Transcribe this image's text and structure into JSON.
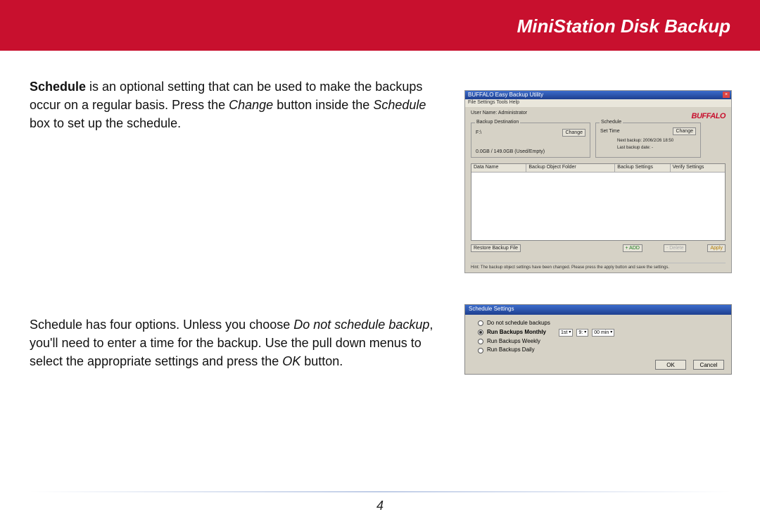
{
  "header": {
    "title": "MiniStation Disk Backup"
  },
  "para1": {
    "lead": "Schedule",
    "rest_a": " is an optional setting that can be used to make the backups occur on a regular basis.  Press the ",
    "em1": "Change",
    "rest_b": " button inside the ",
    "em2": "Schedule",
    "rest_c": " box to set up the schedule."
  },
  "para2": {
    "a": "Schedule has four options.  Unless you choose ",
    "em1": "Do not schedule backup",
    "b": ", you'll need to enter a time for the backup.  Use the pull down menus to select the appropriate settings and press the ",
    "em2": "OK",
    "c": " button."
  },
  "shot1": {
    "title": "BUFFALO Easy Backup Utility",
    "menu": "File   Settings   Tools   Help",
    "brand": "BUFFALO",
    "username": "User Name: Administrator",
    "dest_label": "Backup Destination",
    "dest_drive": "F:\\",
    "dest_change": "Change",
    "dest_size": "0.0GB / 149.0GB  (Used/Empty)",
    "sched_label": "Schedule",
    "sched_settime": "Set Time",
    "sched_change": "Change",
    "sched_next": "Next backup: 2006/2/26 18:50",
    "sched_last": "Last backup date: -",
    "thead": {
      "c1": "Data Name",
      "c2": "Backup Object Folder",
      "c3": "Backup Settings",
      "c4": "Verify Settings"
    },
    "restore": "Restore Backup File",
    "add": "+ ADD",
    "delete": "- Delete",
    "apply": "Apply",
    "hint": "Hint: The backup object settings have been changed. Please press the apply button and save the settings."
  },
  "shot2": {
    "title": "Schedule Settings",
    "opt1": "Do not schedule backups",
    "opt2": "Run Backups Monthly",
    "opt3": "Run Backups Weekly",
    "opt4": "Run Backups Daily",
    "dd_day": "1st",
    "dd_hour": "9:",
    "dd_min": "00 min",
    "ok": "OK",
    "cancel": "Cancel"
  },
  "page_number": "4"
}
